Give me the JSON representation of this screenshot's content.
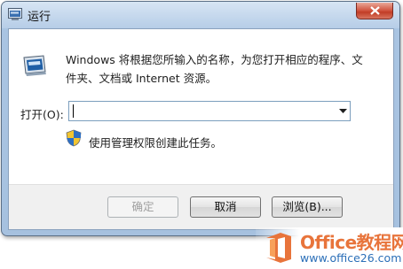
{
  "window": {
    "title": "运行"
  },
  "dialog": {
    "description": "Windows 将根据您所输入的名称，为您打开相应的程序、文件夹、文档或 Internet 资源。",
    "open_label": "打开(O):",
    "open_value": "",
    "admin_note": "使用管理权限创建此任务。"
  },
  "buttons": {
    "ok": "确定",
    "cancel": "取消",
    "browse": "浏览(B)..."
  },
  "watermark": {
    "title": "Office教程网",
    "url": "www.office26.com"
  },
  "colors": {
    "close_red": "#c13d26",
    "office_orange": "#e8743b",
    "link_blue": "#2b6fb8"
  }
}
